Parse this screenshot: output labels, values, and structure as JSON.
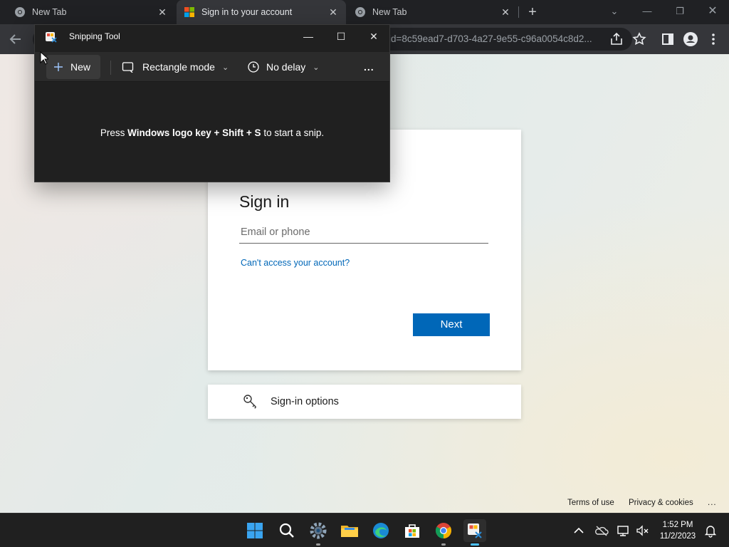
{
  "browser": {
    "tabs": [
      {
        "label": "New Tab",
        "active": false
      },
      {
        "label": "Sign in to your account",
        "active": true
      },
      {
        "label": "New Tab",
        "active": false
      }
    ],
    "address_visible": "id=8c59ead7-d703-4a27-9e55-c96a0054c8d2..."
  },
  "signin": {
    "title": "Sign in",
    "email_placeholder": "Email or phone",
    "cant_access": "Can't access your account?",
    "next": "Next",
    "options": "Sign-in options"
  },
  "footer": {
    "terms": "Terms of use",
    "privacy": "Privacy & cookies",
    "more": "..."
  },
  "snipping_tool": {
    "title": "Snipping Tool",
    "new": "New",
    "mode": "Rectangle mode",
    "delay": "No delay",
    "more": "...",
    "msg_prefix": "Press ",
    "msg_keys": "Windows logo key + Shift + S",
    "msg_suffix": " to start a snip."
  },
  "taskbar": {
    "time": "1:52 PM",
    "date": "11/2/2023"
  },
  "colors": {
    "accent": "#0067b8",
    "taskbar_indicator": "#4cc2ff"
  }
}
